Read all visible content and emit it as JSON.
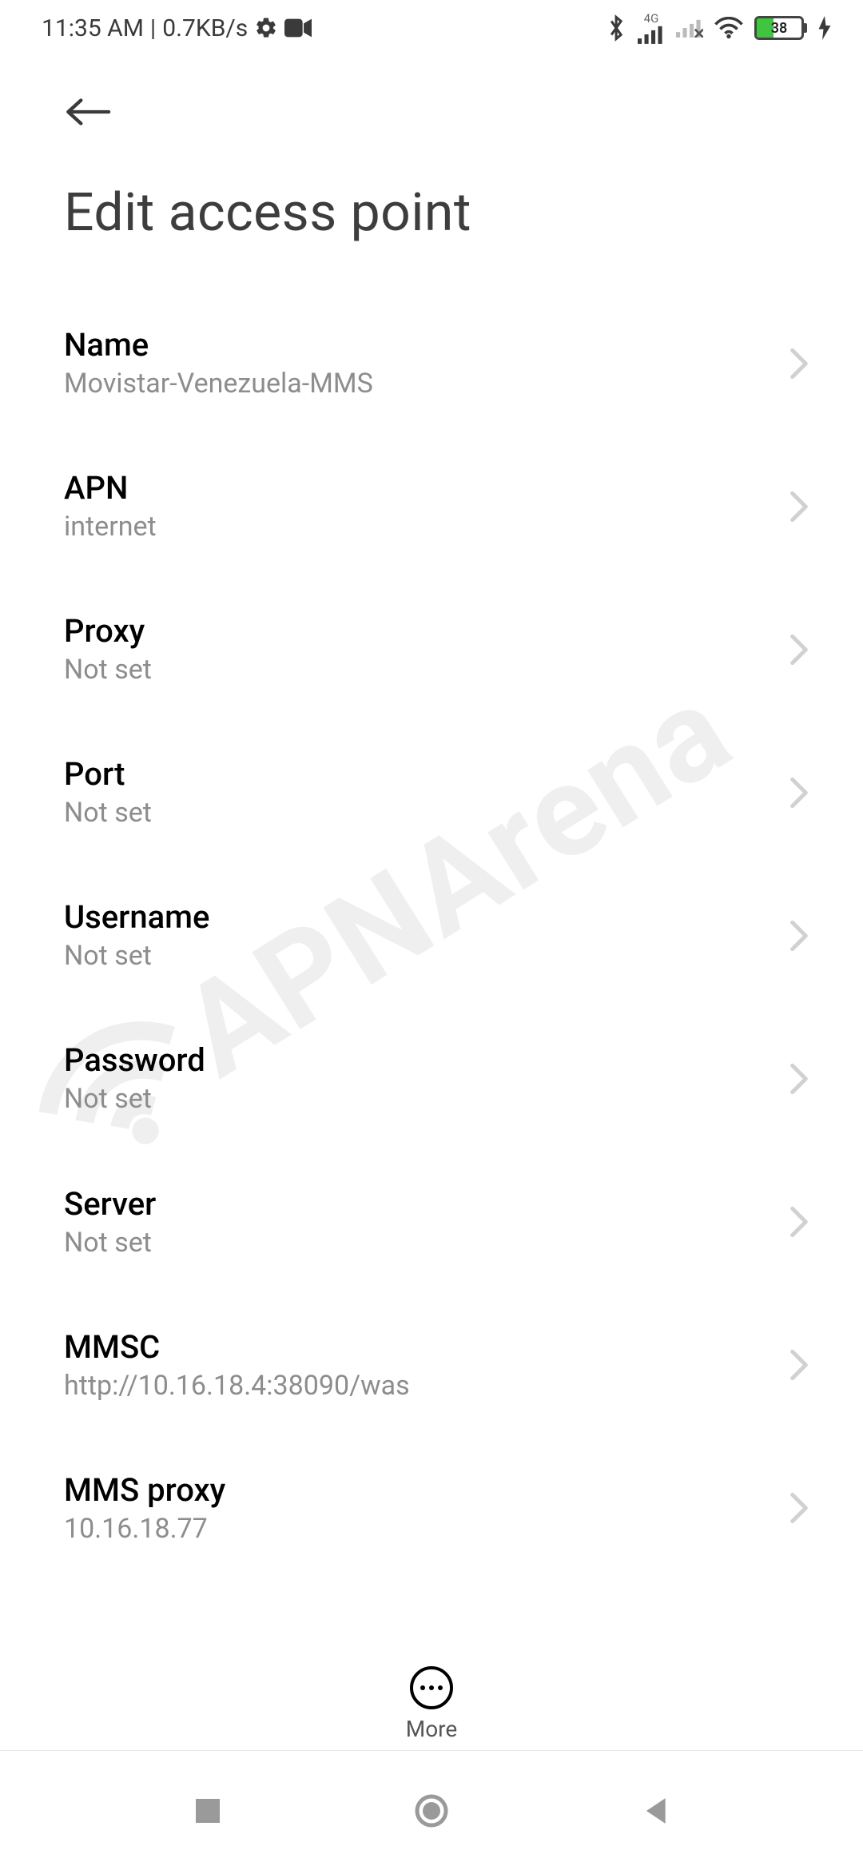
{
  "status_bar": {
    "time": "11:35 AM",
    "separator": "|",
    "speed": "0.7KB/s",
    "network_label_4g": "4G",
    "battery_percent": "38"
  },
  "header": {
    "title": "Edit access point"
  },
  "settings": [
    {
      "key": "name",
      "label": "Name",
      "value": "Movistar-Venezuela-MMS"
    },
    {
      "key": "apn",
      "label": "APN",
      "value": "internet"
    },
    {
      "key": "proxy",
      "label": "Proxy",
      "value": "Not set"
    },
    {
      "key": "port",
      "label": "Port",
      "value": "Not set"
    },
    {
      "key": "username",
      "label": "Username",
      "value": "Not set"
    },
    {
      "key": "password",
      "label": "Password",
      "value": "Not set"
    },
    {
      "key": "server",
      "label": "Server",
      "value": "Not set"
    },
    {
      "key": "mmsc",
      "label": "MMSC",
      "value": "http://10.16.18.4:38090/was"
    },
    {
      "key": "mms-proxy",
      "label": "MMS proxy",
      "value": "10.16.18.77"
    }
  ],
  "more": {
    "label": "More"
  },
  "watermark": {
    "text": "APNArena"
  }
}
